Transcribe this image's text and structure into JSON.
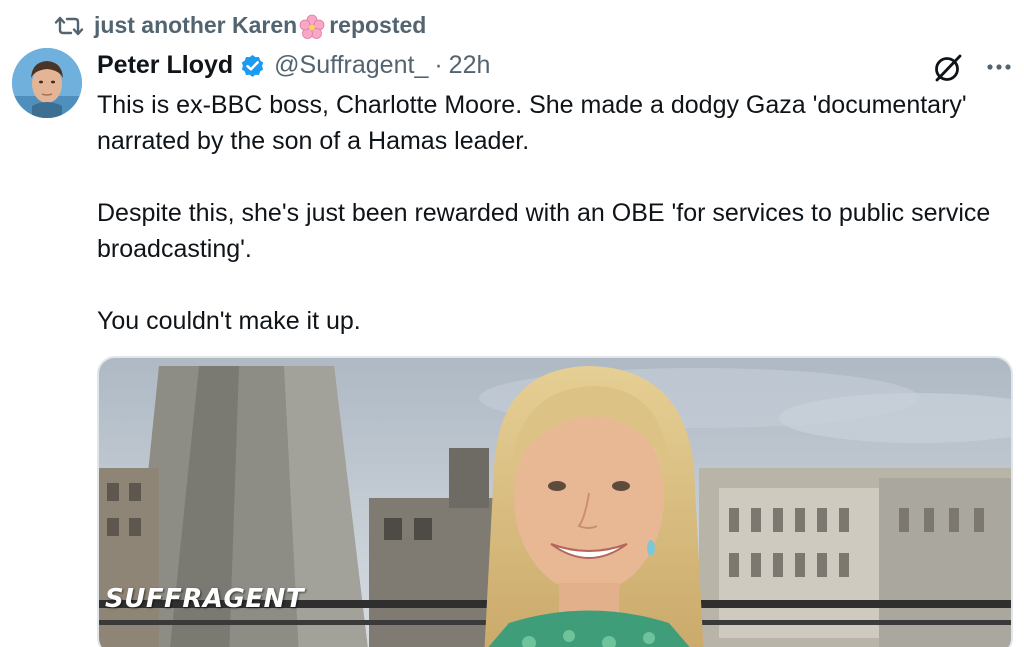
{
  "repost_bar": {
    "reposter_name": "just another Karen",
    "reposter_emoji_icon": "cherry-blossom-icon",
    "label": "reposted"
  },
  "author": {
    "display_name": "Peter Lloyd",
    "verified_icon": "verified-badge-icon",
    "handle": "@Suffragent_",
    "separator": "·",
    "time": "22h"
  },
  "tweet": {
    "paragraphs": [
      "This is ex-BBC boss, Charlotte Moore. She made a dodgy Gaza 'documentary' narrated by the son of a Hamas leader.",
      "Despite this, she's just been rewarded with an OBE 'for services to public service broadcasting'.",
      "You couldn't make it up."
    ]
  },
  "media": {
    "watermark": "SUFFRAGENT"
  },
  "icons": {
    "repost": "repost-icon",
    "grok": "grok-icon",
    "more": "more-icon"
  },
  "colors": {
    "text_primary": "#0f1419",
    "text_secondary": "#536471",
    "verified_blue": "#1d9bf0"
  }
}
